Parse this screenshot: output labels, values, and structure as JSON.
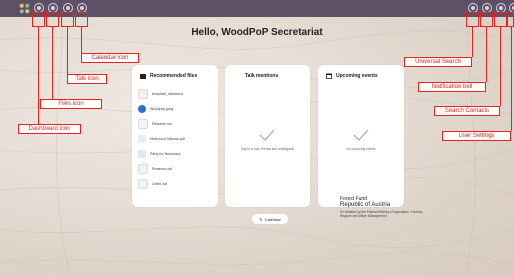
{
  "header": {
    "greeting": "Hello, WoodPoP Secretariat"
  },
  "annotations": {
    "calendar_icon": "Calendar icon",
    "talk_icon": "Talk icon",
    "files_icon": "Files icon",
    "dashboard_icon": "Dashboard icon",
    "universal_search": "Universal Search",
    "notification_bell": "Notification bell",
    "search_contacts": "Search Contacts",
    "user_settings": "User Settings"
  },
  "panels": {
    "files": {
      "title": "Recommended files",
      "items": [
        {
          "name": "template_dashbord",
          "color": "#f0f0f0"
        },
        {
          "name": "Woodpop.jpeg",
          "color": "#2f6fd0"
        },
        {
          "name": "Readme.md",
          "color": "#f4f4f4"
        },
        {
          "name": "Nextcloud Manual.pdf",
          "color": "#e6eef8"
        },
        {
          "name": "Party for Nextcloud",
          "color": "#dfe9f6"
        },
        {
          "name": "Reasons.odt",
          "color": "#f2f2f2"
        },
        {
          "name": "Letter.odt",
          "color": "#f2f2f2"
        }
      ]
    },
    "talk": {
      "title": "Talk mentions",
      "empty": "Say hi to your friends and colleagues!"
    },
    "events": {
      "title": "Upcoming events",
      "empty": "No upcoming events"
    }
  },
  "calendar_button": "Calendar",
  "footer_logo": {
    "line1": "Forest Fund",
    "line2": "Republic of Austria",
    "small": "An initiative by the Federal Ministry of Agriculture, Forestry, Regions and Water Management"
  },
  "colors": {
    "topbar": "#5e5066",
    "annotation": "#e2251f"
  }
}
